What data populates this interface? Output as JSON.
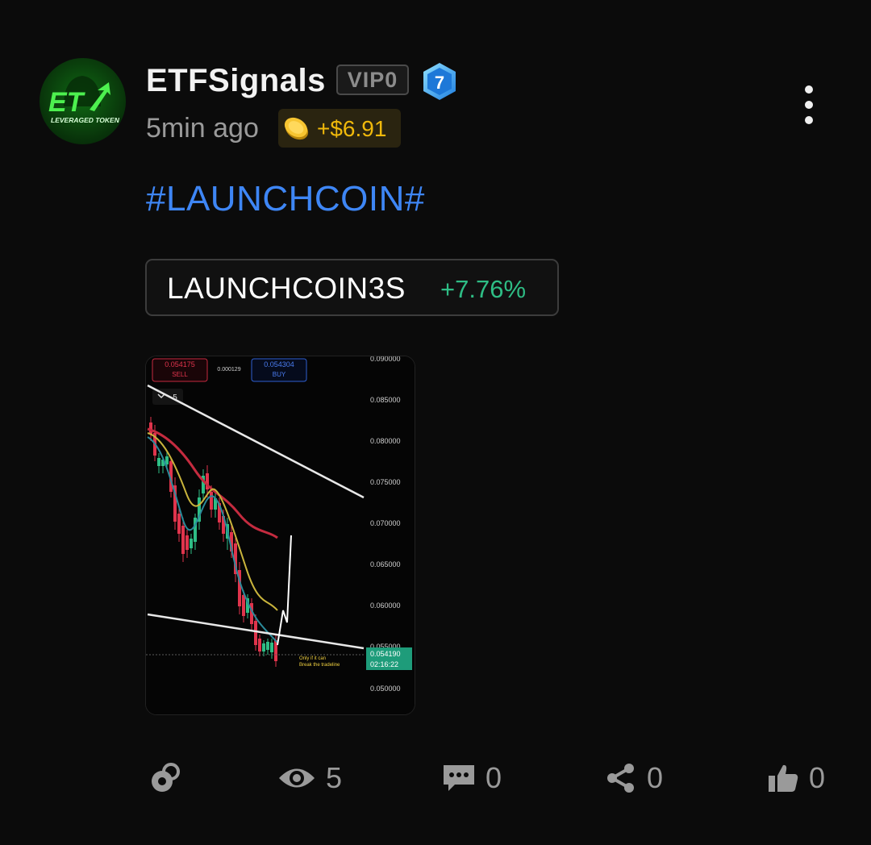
{
  "post": {
    "author": {
      "name": "ETFSignals",
      "vip_label": "VIP0",
      "level": "7",
      "avatar_text": "ET",
      "avatar_subtext": "LEVERAGED TOKEN"
    },
    "time": "5min ago",
    "tip_amount": "+$6.91",
    "hashtag": "#LAUNCHCOIN#",
    "ticker": {
      "symbol": "LAUNCHCOIN3S",
      "change": "+7.76%",
      "change_color": "#2ebd85"
    },
    "screenshot": {
      "sell_price": "0.054175",
      "sell_label": "SELL",
      "spread": "0.000129",
      "buy_price": "0.054304",
      "buy_label": "BUY",
      "interval": "5",
      "price_ticks": [
        "0.090000",
        "0.085000",
        "0.080000",
        "0.075000",
        "0.070000",
        "0.065000",
        "0.060000",
        "0.055000",
        "0.050000"
      ],
      "current_price": "0.054190",
      "countdown": "02:16:22",
      "note_line1": "Only if it can",
      "note_line2": "Break the tradeline"
    },
    "actions": [
      {
        "icon": "repost-icon",
        "count": ""
      },
      {
        "icon": "eye-icon",
        "count": "5"
      },
      {
        "icon": "comment-icon",
        "count": "0"
      },
      {
        "icon": "share-icon",
        "count": "0"
      },
      {
        "icon": "thumbs-up-icon",
        "count": "0"
      }
    ]
  },
  "colors": {
    "accent_blue": "#3e86f5",
    "positive": "#2ebd85",
    "gold": "#f0b90b",
    "sell": "#e0344c"
  }
}
